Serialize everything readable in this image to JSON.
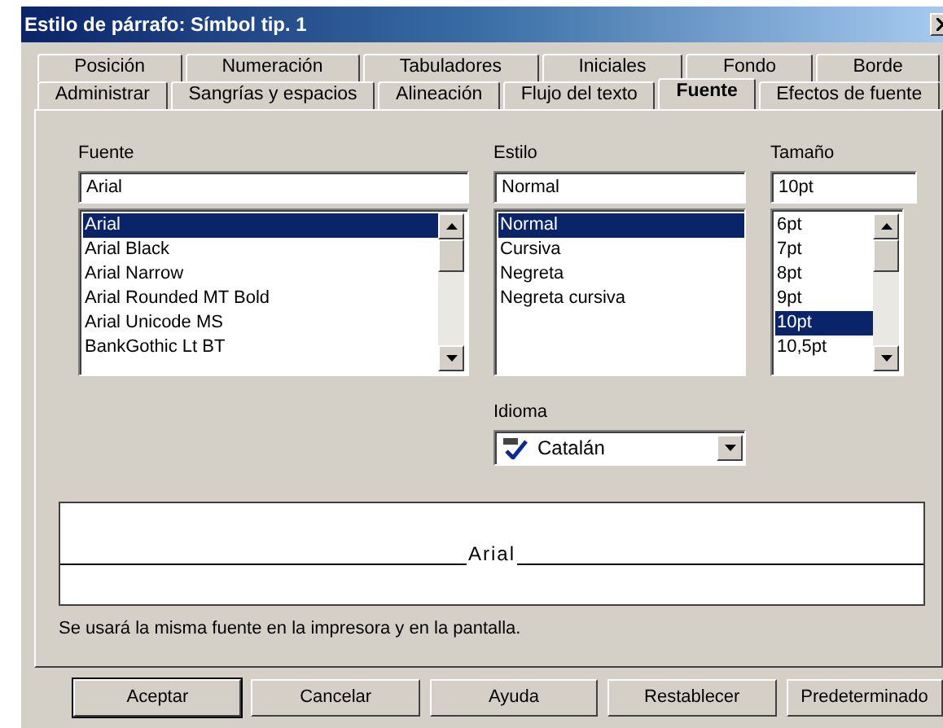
{
  "window": {
    "title": "Estilo de párrafo: Símbol tip. 1"
  },
  "tab_rows": [
    [
      {
        "label": "Posición",
        "selected": false
      },
      {
        "label": "Numeración",
        "selected": false
      },
      {
        "label": "Tabuladores",
        "selected": false
      },
      {
        "label": "Iniciales",
        "selected": false
      },
      {
        "label": "Fondo",
        "selected": false
      },
      {
        "label": "Borde",
        "selected": false
      }
    ],
    [
      {
        "label": "Administrar",
        "selected": false
      },
      {
        "label": "Sangrías y espacios",
        "selected": false
      },
      {
        "label": "Alineación",
        "selected": false
      },
      {
        "label": "Flujo del texto",
        "selected": false
      },
      {
        "label": "Fuente",
        "selected": true
      },
      {
        "label": "Efectos de fuente",
        "selected": false
      }
    ]
  ],
  "font": {
    "label": "Fuente",
    "value": "Arial",
    "scrollbar": true,
    "items": [
      {
        "label": "Arial",
        "selected": true
      },
      {
        "label": "Arial Black",
        "selected": false
      },
      {
        "label": "Arial Narrow",
        "selected": false
      },
      {
        "label": "Arial Rounded MT Bold",
        "selected": false
      },
      {
        "label": "Arial Unicode MS",
        "selected": false
      },
      {
        "label": "BankGothic Lt BT",
        "selected": false
      }
    ]
  },
  "style": {
    "label": "Estilo",
    "value": "Normal",
    "scrollbar": false,
    "items": [
      {
        "label": "Normal",
        "selected": true
      },
      {
        "label": "Cursiva",
        "selected": false
      },
      {
        "label": "Negreta",
        "selected": false
      },
      {
        "label": "Negreta cursiva",
        "selected": false
      }
    ]
  },
  "size": {
    "label": "Tamaño",
    "value": "10pt",
    "scrollbar": true,
    "items": [
      {
        "label": "6pt",
        "selected": false
      },
      {
        "label": "7pt",
        "selected": false
      },
      {
        "label": "8pt",
        "selected": false
      },
      {
        "label": "9pt",
        "selected": false
      },
      {
        "label": "10pt",
        "selected": true
      },
      {
        "label": "10,5pt",
        "selected": false
      }
    ]
  },
  "language": {
    "label": "Idioma",
    "value": "Catalán"
  },
  "preview": {
    "text": "Arial"
  },
  "note": "Se usará la misma fuente en la impresora y en la pantalla.",
  "buttons": [
    {
      "label": "Aceptar",
      "default": true
    },
    {
      "label": "Cancelar",
      "default": false
    },
    {
      "label": "Ayuda",
      "default": false
    },
    {
      "label": "Restablecer",
      "default": false
    },
    {
      "label": "Predeterminado",
      "default": false
    }
  ]
}
